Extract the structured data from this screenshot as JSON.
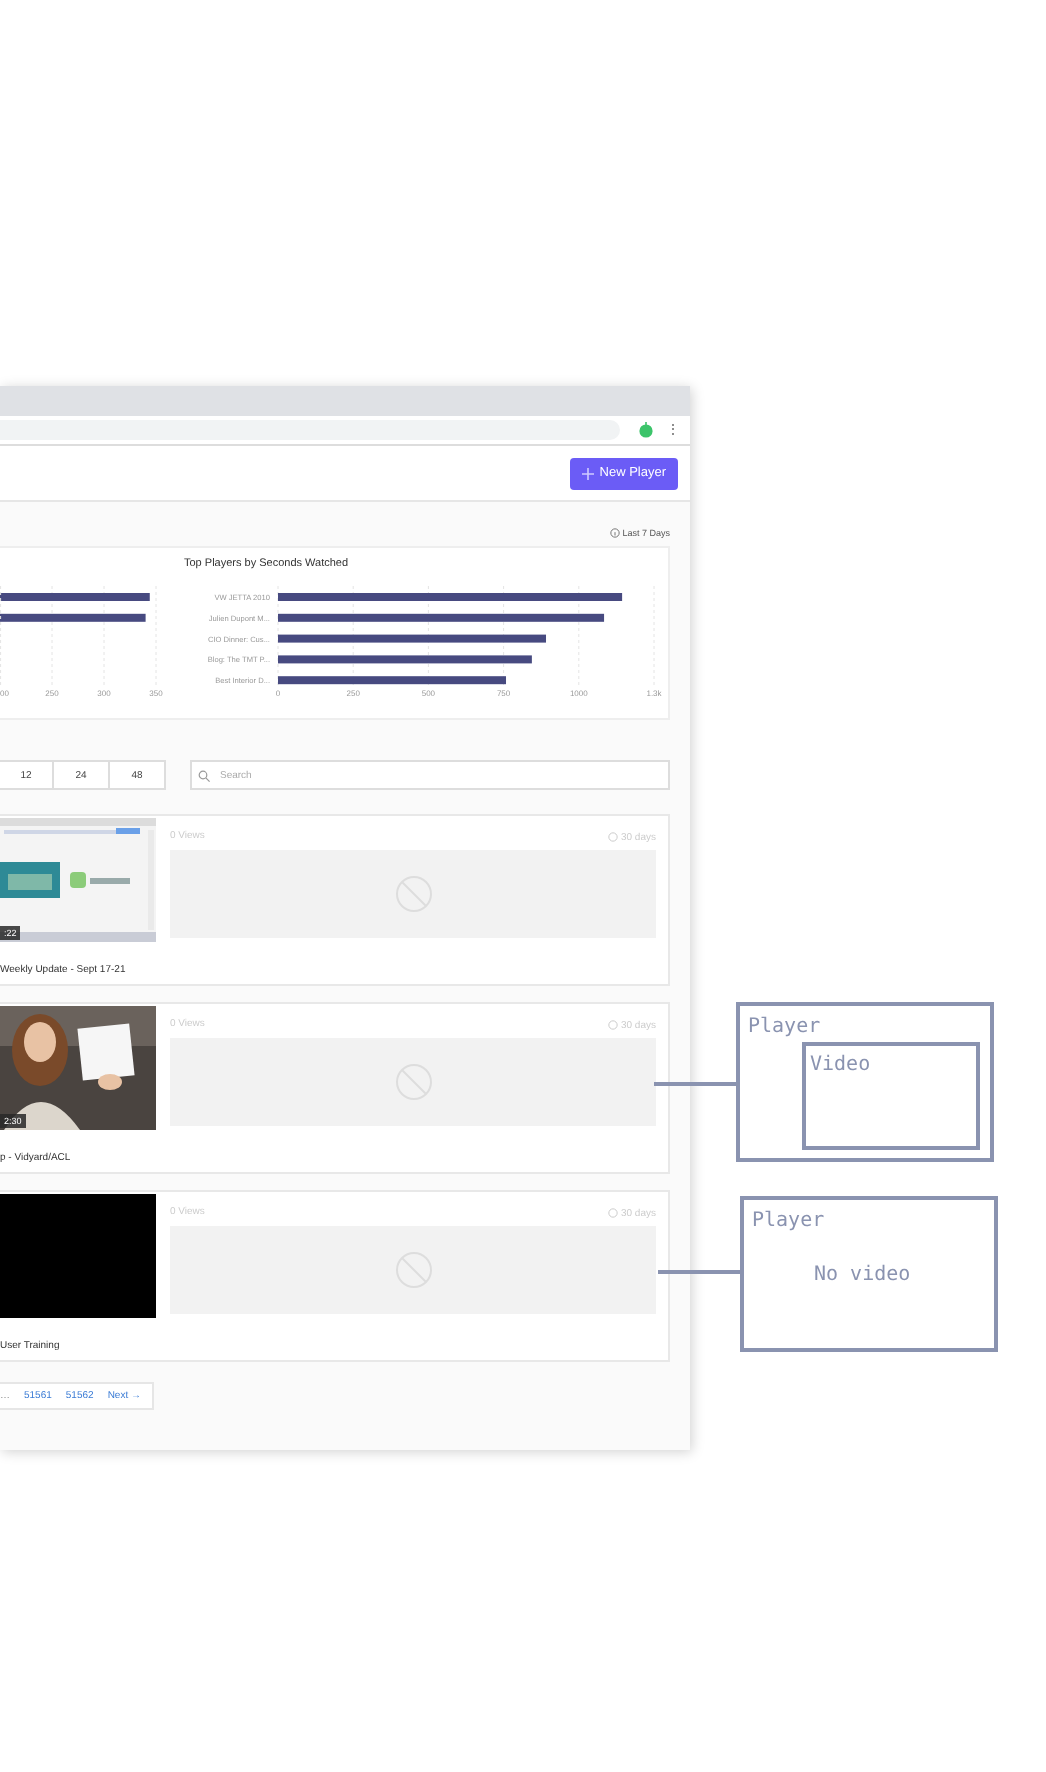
{
  "browser": {
    "menu_icon": "⋮"
  },
  "header": {
    "new_player_button": "New Player"
  },
  "date_range": "Last 7 Days",
  "charts": [
    {
      "cut_tick_label": "00",
      "chart_data": {
        "type": "bar",
        "orientation": "horizontal",
        "values": [
          344,
          340,
          null,
          null,
          null
        ],
        "xlim": [
          200,
          350
        ],
        "grid": true,
        "xticks": [
          250,
          300,
          350
        ]
      }
    },
    {
      "chart_data": {
        "type": "bar",
        "orientation": "horizontal",
        "title": "Top Players by Seconds Watched",
        "categories": [
          "VW JETTA 2010",
          "Julien Dupont M...",
          "CIO Dinner: Cus...",
          "Blog: The TMT P...",
          "Best Interior D..."
        ],
        "values": [
          1144,
          1084,
          891,
          844,
          758
        ],
        "xlim": [
          0,
          1250
        ],
        "grid": true,
        "xticks": [
          0,
          250,
          500,
          750,
          1000,
          {
            "value": 1250,
            "label": "1.3k"
          }
        ]
      }
    }
  ],
  "page_sizes": [
    "12",
    "24",
    "48"
  ],
  "search": {
    "placeholder": "Search"
  },
  "videos": [
    {
      "duration": ":22",
      "title": "Weekly Update - Sept 17-21",
      "views": "0 Views",
      "age": "30 days"
    },
    {
      "duration": "2:30",
      "title": "p - Vidyard/ACL",
      "views": "0 Views",
      "age": "30 days"
    },
    {
      "title": "User Training",
      "views": "0 Views",
      "age": "30 days"
    }
  ],
  "pagination": {
    "pages": [
      "…",
      "51561",
      "51562"
    ],
    "next": "Next →"
  },
  "annotations": [
    {
      "kind": "nested",
      "title": "Player",
      "inner": "Video"
    },
    {
      "kind": "plain",
      "title": "Player",
      "body": "No video"
    }
  ]
}
